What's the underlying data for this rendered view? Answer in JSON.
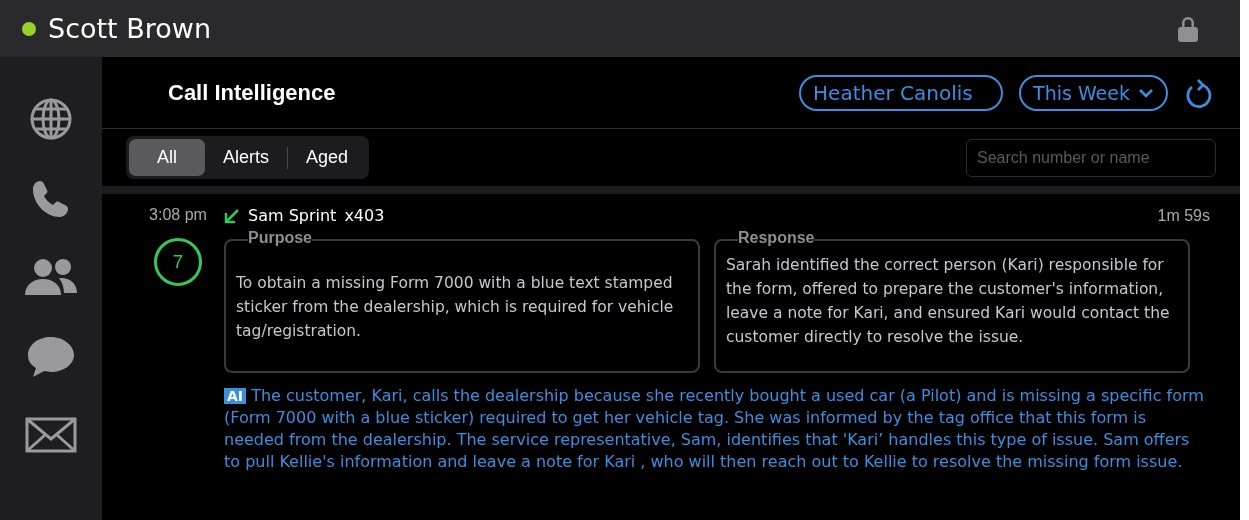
{
  "user": {
    "name": "Scott Brown",
    "online": true
  },
  "header": {
    "title": "Call Intelligence",
    "agent": "Heather Canolis",
    "period": "This Week"
  },
  "tabs": [
    {
      "label": "All",
      "selected": true
    },
    {
      "label": "Alerts",
      "selected": false
    },
    {
      "label": "Aged",
      "selected": false
    }
  ],
  "search": {
    "placeholder": "Search number or name"
  },
  "calls": [
    {
      "time": "3:08 pm",
      "kind": "inbound",
      "caller": "Sam Sprint",
      "extension": "x403",
      "duration": "1m 59s",
      "score": "7",
      "purpose": {
        "label": "Purpose",
        "text": "To obtain a missing Form 7000 with a blue text stamped sticker from the dealership, which is required for vehicle tag/registration."
      },
      "response": {
        "label": "Response",
        "text": "Sarah identified the correct person (Kari) responsible for the form, offered to prepare the customer's information, leave a note for Kari, and ensured Kari would contact the customer directly to resolve the issue."
      },
      "ai_badge": "AI",
      "summary": "The customer, Kari, calls the dealership because she recently bought a used car (a Pilot) and is missing a specific form (Form 7000 with a blue sticker) required to get her vehicle tag. She was informed by the tag office that this form is needed from the dealership. The service representative, Sam, identifies that 'Kari’ handles this type of issue. Sam offers to pull Kellie's information and leave a note for Kari , who will then reach out to Kellie to resolve the missing form issue."
    }
  ]
}
